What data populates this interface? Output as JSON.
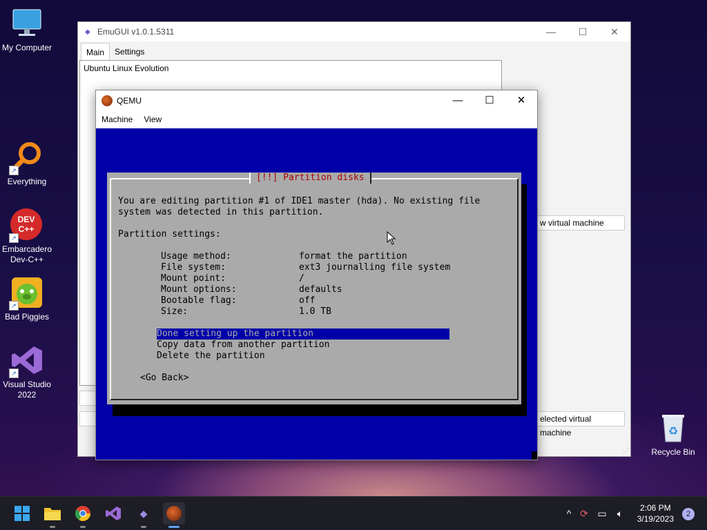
{
  "desktop": {
    "icons": [
      {
        "label": "My Computer"
      },
      {
        "label": "Everything"
      },
      {
        "label": "Embarcadero Dev-C++",
        "glyph_text": "DEV C++"
      },
      {
        "label": "Bad Piggies"
      },
      {
        "label": "Visual Studio 2022"
      },
      {
        "label": "Recycle Bin"
      }
    ]
  },
  "emugui": {
    "title": "EmuGUI v1.0.1.5311",
    "tabs": [
      "Main",
      "Settings"
    ],
    "vm_list": [
      "Ubuntu Linux Evolution"
    ],
    "buttons": {
      "new_vm": "w virtual machine",
      "delete_vm": "elected virtual machine"
    }
  },
  "qemu": {
    "title": "QEMU",
    "menu": [
      "Machine",
      "View"
    ],
    "installer": {
      "dialog_title": "[!!] Partition disks",
      "intro_line1": "You are editing partition #1 of IDE1 master (hda). No existing file",
      "intro_line2": "system was detected in this partition.",
      "settings_heading": "Partition settings:",
      "settings": [
        {
          "key": "Usage method:",
          "value": "format the partition"
        },
        {
          "key": "File system:",
          "value": "ext3 journalling file system"
        },
        {
          "key": "Mount point:",
          "value": "/"
        },
        {
          "key": "Mount options:",
          "value": "defaults"
        },
        {
          "key": "Bootable flag:",
          "value": "off"
        },
        {
          "key": "Size:",
          "value": "1.0 TB"
        }
      ],
      "actions": [
        "Done setting up the partition",
        "Copy data from another partition",
        "Delete the partition"
      ],
      "selected_action": "Done setting up the partition",
      "go_back": "<Go Back>"
    }
  },
  "taskbar": {
    "clock_time": "2:06 PM",
    "clock_date": "3/19/2023",
    "notification_count": "2"
  },
  "colors": {
    "installer_blue": "#0000a8",
    "installer_gray": "#aaaaaa",
    "installer_title_red": "#a80000"
  }
}
